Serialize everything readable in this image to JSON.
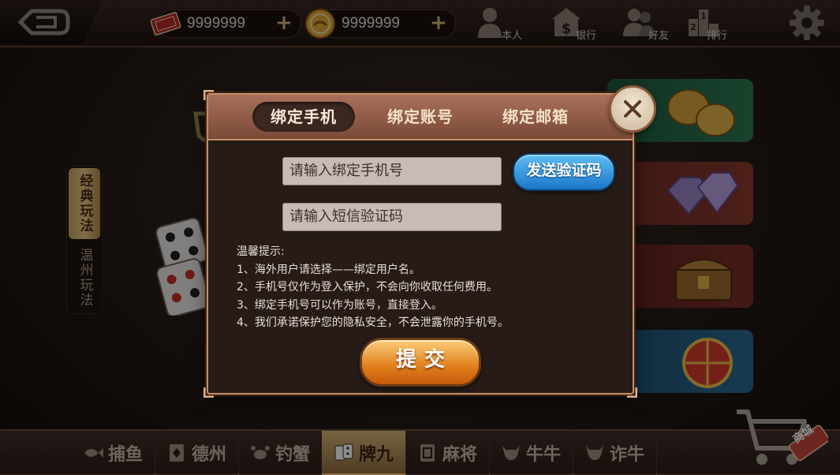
{
  "topbar": {
    "currencies": [
      {
        "icon": "ticket-icon",
        "value": "9999999",
        "add": "+"
      },
      {
        "icon": "gold-coin-icon",
        "value": "9999999",
        "add": "+"
      }
    ],
    "nav": [
      {
        "icon": "person-icon",
        "label": "本人"
      },
      {
        "icon": "bank-icon",
        "label": "银行"
      },
      {
        "icon": "friends-icon",
        "label": "好友"
      },
      {
        "icon": "ranking-icon",
        "label": "排行"
      }
    ]
  },
  "sidebar": {
    "tabs": [
      {
        "label": "经典玩法",
        "active": true
      },
      {
        "label": "温州玩法",
        "active": false
      }
    ]
  },
  "bottom_nav": {
    "tabs": [
      {
        "label": "捕鱼",
        "icon": "fish-icon"
      },
      {
        "label": "德州",
        "icon": "card-icon"
      },
      {
        "label": "钓蟹",
        "icon": "crab-icon"
      },
      {
        "label": "牌九",
        "icon": "domino-icon",
        "active": true
      },
      {
        "label": "麻将",
        "icon": "mahjong-icon"
      },
      {
        "label": "牛牛",
        "icon": "bull-icon"
      },
      {
        "label": "诈牛",
        "icon": "bull-icon-2"
      }
    ],
    "shop_label": "商城"
  },
  "dialog": {
    "tabs": [
      {
        "label": "绑定手机",
        "active": true
      },
      {
        "label": "绑定账号",
        "active": false
      },
      {
        "label": "绑定邮箱",
        "active": false
      }
    ],
    "phone_placeholder": "请输入绑定手机号",
    "code_placeholder": "请输入短信验证码",
    "send_code_label": "发送验证码",
    "tips_title": "温馨提示:",
    "tips": [
      "1、海外用户请选择——绑定用户名。",
      "2、手机号仅作为登入保护，不会向你收取任何费用。",
      "3、绑定手机号可以作为账号，直接登入。",
      "4、我们承诺保护您的隐私安全，不会泄露你的手机号。"
    ],
    "submit_label": "提交"
  },
  "colors": {
    "accent_gold": "#d7b57a",
    "dialog_border": "#c48f68",
    "send_button": "#1b78c9",
    "submit_button": "#e27e1c"
  }
}
